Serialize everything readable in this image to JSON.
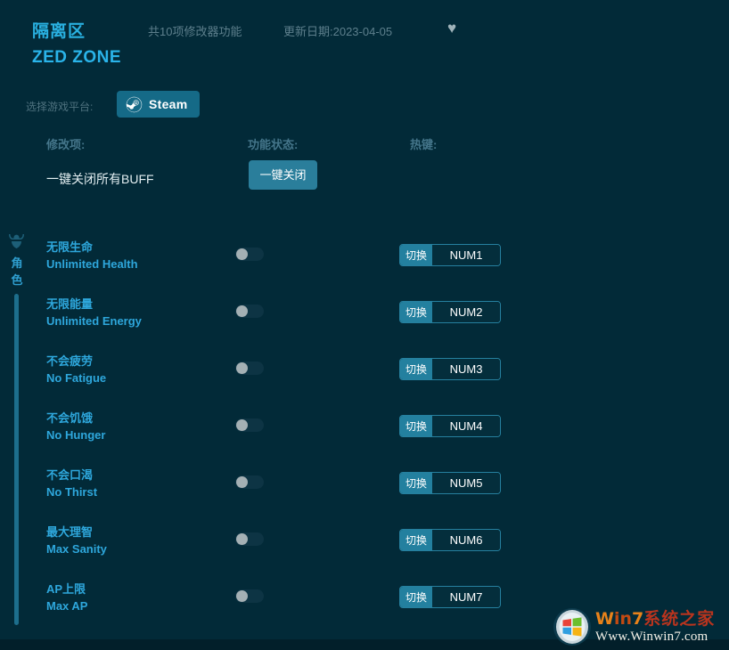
{
  "header": {
    "title_cn": "隔离区",
    "title_en": "ZED ZONE",
    "feature_count": "共10项修改器功能",
    "update_date": "更新日期:2023-04-05",
    "favorite_icon": "♥"
  },
  "platform": {
    "label": "选择游戏平台:",
    "selected": "Steam"
  },
  "columns": {
    "name": "修改项:",
    "status": "功能状态:",
    "hotkey": "热键:"
  },
  "buff": {
    "label": "一键关闭所有BUFF",
    "button": "一键关闭"
  },
  "category": {
    "label": "角色",
    "icon": "character-icon"
  },
  "rows": [
    {
      "cn": "无限生命",
      "en": "Unlimited Health",
      "state": "off",
      "action": "切换",
      "key": "NUM1"
    },
    {
      "cn": "无限能量",
      "en": "Unlimited Energy",
      "state": "off",
      "action": "切换",
      "key": "NUM2"
    },
    {
      "cn": "不会疲劳",
      "en": "No Fatigue",
      "state": "off",
      "action": "切换",
      "key": "NUM3"
    },
    {
      "cn": "不会饥饿",
      "en": "No Hunger",
      "state": "off",
      "action": "切换",
      "key": "NUM4"
    },
    {
      "cn": "不会口渴",
      "en": "No Thirst",
      "state": "off",
      "action": "切换",
      "key": "NUM5"
    },
    {
      "cn": "最大理智",
      "en": "Max Sanity",
      "state": "off",
      "action": "切换",
      "key": "NUM6"
    },
    {
      "cn": "AP上限",
      "en": "Max AP",
      "state": "off",
      "action": "切换",
      "key": "NUM7"
    }
  ],
  "watermark": {
    "brand_win": "W",
    "brand_in": "in",
    "brand_7": "7",
    "brand_cn": "系统之家",
    "url": "Www.Winwin7.com"
  },
  "colors": {
    "background": "#022a38",
    "accent": "#2ea7dc",
    "button": "#2a7e9b",
    "steam": "#156a87",
    "muted": "#5d7f8c",
    "rail": "#1d6e8c"
  }
}
